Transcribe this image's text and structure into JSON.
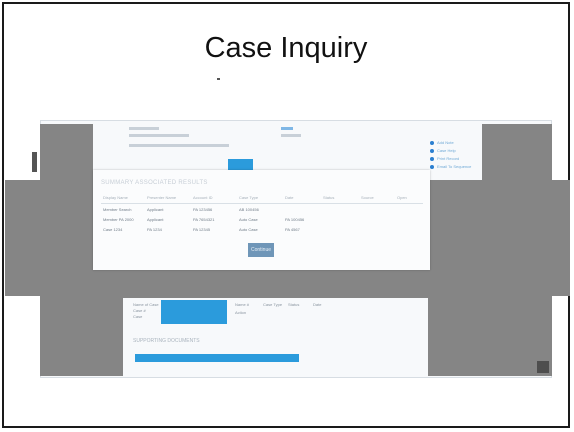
{
  "slide": {
    "title": "Case Inquiry"
  },
  "modal": {
    "title": "SUMMARY ASSOCIATED RESULTS",
    "columns": [
      "Display Name",
      "Presenter Name",
      "Account ID",
      "Case Type",
      "Date",
      "Status",
      "Source",
      "Open"
    ],
    "rows": [
      [
        "Member Search",
        "Applicant",
        "PA 123456",
        "AB 100456",
        "",
        "",
        "",
        ""
      ],
      [
        "Member PA 2000",
        "Applicant",
        "PA 7654321",
        "Auto Case",
        "PA 100456",
        "",
        "",
        ""
      ],
      [
        "Case 1234",
        "PA 1234",
        "PA 12345",
        "Auto Case",
        "PA 4567",
        "",
        "",
        ""
      ]
    ],
    "continue_label": "Continue"
  },
  "side_menu": {
    "items": [
      "Add Note",
      "Case Help",
      "Print Record",
      "Email To Sequence"
    ]
  },
  "lower": {
    "section_title": "SUPPORTING DOCUMENTS",
    "labels": [
      "Name of Case",
      "Case #",
      "Case",
      "Name #",
      "Case Type",
      "Status",
      "Date",
      "Action"
    ]
  },
  "colors": {
    "accent_blue": "#2b9bdc",
    "overlay_gray": "#858585",
    "button_gray_blue": "#6f96b8"
  }
}
